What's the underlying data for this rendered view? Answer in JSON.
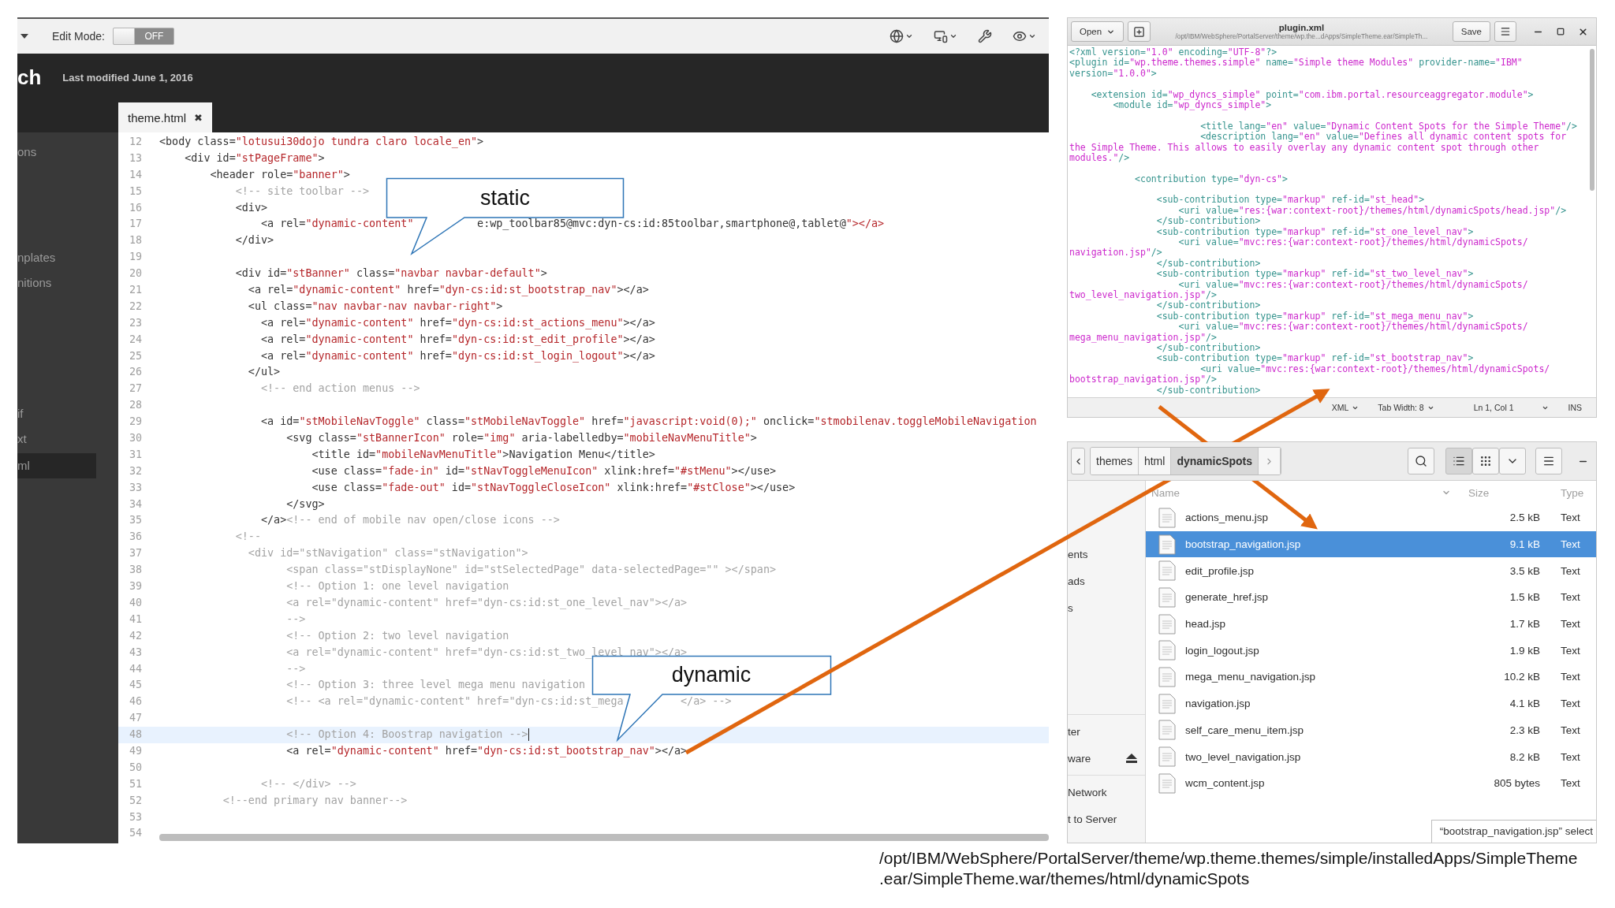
{
  "portal_toolbar": {
    "edit_mode_label": "Edit Mode:",
    "edit_mode_toggle": {
      "label": "OFF",
      "on": false
    }
  },
  "portal_header": {
    "title_fragment": "ch",
    "last_modified": "Last modified June 1, 2016"
  },
  "editor_tab": {
    "label": "theme.html",
    "close": "✖"
  },
  "sidebar_items": [
    {
      "label": "ons",
      "selected": false
    },
    {
      "label": "nplates",
      "selected": false
    },
    {
      "label": "nitions",
      "selected": false
    },
    {
      "label": "if",
      "selected": false
    },
    {
      "label": "xt",
      "selected": false
    },
    {
      "label": "ml",
      "selected": true
    }
  ],
  "code_lines": [
    {
      "number": "12",
      "text": "<body class=\"lotusui30dojo tundra claro locale_en\">",
      "current": false
    },
    {
      "number": "13",
      "text": "    <div id=\"stPageFrame\">",
      "current": false
    },
    {
      "number": "14",
      "text": "        <header role=\"banner\">",
      "current": false
    },
    {
      "number": "15",
      "text": "            <!-- site toolbar -->",
      "current": false
    },
    {
      "number": "16",
      "text": "            <div>",
      "current": false
    },
    {
      "number": "17",
      "segments": [
        "                <a rel=\"dynamic-content\" ",
        "e:wp_toolbar85@mvc:dyn-cs:id:85toolbar,smartphone@,tablet@\"></a>"
      ],
      "current": false
    },
    {
      "number": "18",
      "text": "            </div>",
      "current": false
    },
    {
      "number": "19",
      "current": false
    },
    {
      "number": "20",
      "text": "            <div id=\"stBanner\" class=\"navbar navbar-default\">",
      "current": false
    },
    {
      "number": "21",
      "text": "              <a rel=\"dynamic-content\" href=\"dyn-cs:id:st_bootstrap_nav\"></a>",
      "current": false
    },
    {
      "number": "22",
      "text": "              <ul class=\"nav navbar-nav navbar-right\">",
      "current": false
    },
    {
      "number": "23",
      "text": "                <a rel=\"dynamic-content\" href=\"dyn-cs:id:st_actions_menu\"></a>",
      "current": false
    },
    {
      "number": "24",
      "text": "                <a rel=\"dynamic-content\" href=\"dyn-cs:id:st_edit_profile\"></a>",
      "current": false
    },
    {
      "number": "25",
      "text": "                <a rel=\"dynamic-content\" href=\"dyn-cs:id:st_login_logout\"></a>",
      "current": false
    },
    {
      "number": "26",
      "text": "              </ul>",
      "current": false
    },
    {
      "number": "27",
      "text": "                <!-- end action menus -->",
      "current": false
    },
    {
      "number": "28",
      "current": false
    },
    {
      "number": "29",
      "text": "                <a id=\"stMobileNavToggle\" class=\"stMobileNavToggle\" href=\"javascript:void(0);\" onclick=\"stmobilenav.toggleMobileNavigation",
      "current": false
    },
    {
      "number": "30",
      "text": "                    <svg class=\"stBannerIcon\" role=\"img\" aria-labelledby=\"mobileNavMenuTitle\">",
      "current": false
    },
    {
      "number": "31",
      "text": "                        <title id=\"mobileNavMenuTitle\">Navigation Menu</title>",
      "current": false
    },
    {
      "number": "32",
      "text": "                        <use class=\"fade-in\" id=\"stNavToggleMenuIcon\" xlink:href=\"#stMenu\"></use>",
      "current": false
    },
    {
      "number": "33",
      "text": "                        <use class=\"fade-out\" id=\"stNavToggleCloseIcon\" xlink:href=\"#stClose\"></use>",
      "current": false
    },
    {
      "number": "34",
      "text": "                    </svg>",
      "current": false
    },
    {
      "number": "35",
      "text": "                </a><!-- end of mobile nav open/close icons -->",
      "current": false
    },
    {
      "number": "36",
      "text": "            <!--",
      "current": false
    },
    {
      "number": "37",
      "text": "              <div id=\"stNavigation\" class=\"stNavigation\">",
      "current": false
    },
    {
      "number": "38",
      "text": "                    <span class=\"stDisplayNone\" id=\"stSelectedPage\" data-selectedPage=\"\" ></span>",
      "current": false
    },
    {
      "number": "39",
      "text": "                    <!-- Option 1: one level navigation",
      "current": false
    },
    {
      "number": "40",
      "text": "                    <a rel=\"dynamic-content\" href=\"dyn-cs:id:st_one_level_nav\"></a>",
      "current": false
    },
    {
      "number": "41",
      "text": "                    -->",
      "current": false
    },
    {
      "number": "42",
      "text": "                    <!-- Option 2: two level navigation",
      "current": false
    },
    {
      "number": "43",
      "text": "                    <a rel=\"dynamic-content\" href=\"dyn-cs:id:st_two_level_nav\"></a>",
      "current": false
    },
    {
      "number": "44",
      "text": "                    -->",
      "current": false
    },
    {
      "number": "45",
      "text": "                    <!-- Option 3: three level mega menu navigation",
      "current": false
    },
    {
      "number": "46",
      "segments": [
        "                    <!-- <a rel=\"dynamic-content\" href=\"dyn-cs:id:st_mega",
        "</a> -->"
      ],
      "current": false
    },
    {
      "number": "47",
      "current": false
    },
    {
      "number": "48",
      "text": "                    <!-- Option 4: Boostrap navigation -->",
      "current": true
    },
    {
      "number": "49",
      "text": "                    <a rel=\"dynamic-content\" href=\"dyn-cs:id:st_bootstrap_nav\"></a>",
      "current": false
    },
    {
      "number": "50",
      "current": false
    },
    {
      "number": "51",
      "text": "                <!-- </div> -->",
      "current": false
    },
    {
      "number": "52",
      "text": "          <!--end primary nav banner-->",
      "current": false
    },
    {
      "number": "53",
      "current": false
    },
    {
      "number": "54",
      "current": false
    }
  ],
  "callouts": [
    {
      "text": "static"
    },
    {
      "text": "dynamic"
    }
  ],
  "text_editor": {
    "open_button": "Open",
    "title": "plugin.xml",
    "subtitle": "/opt/IBM/WebSphere/PortalServer/theme/wp.the...dApps/SimpleTheme.ear/SimpleTh...",
    "save_button": "Save",
    "blocks": [
      [
        {
          "text": "<?xml version=\"1.0\" encoding=\"UTF-8\"?>"
        },
        {
          "text": "<plugin id=\"wp.theme.themes.simple\" name=\"Simple theme Modules\" provider-name=\"IBM\""
        },
        {
          "text": "version=\"1.0.0\">"
        }
      ],
      [
        {
          "text": "    <extension id=\"wp_dyncs_simple\" point=\"com.ibm.portal.resourceaggregator.module\">"
        },
        {
          "text": "        <module id=\"wp_dyncs_simple\">"
        }
      ],
      [
        {
          "text": "                        <title lang=\"en\" value=\"Dynamic Content Spots for the Simple Theme\"/>"
        },
        {
          "text": "                        <description lang=\"en\" value=\"Defines all dynamic content spots for"
        },
        {
          "text": "the Simple Theme. This allows to easily overlay any dynamic content spot through other"
        },
        {
          "text": "modules.\"/>"
        }
      ],
      [
        {
          "text": "            <contribution type=\"dyn-cs\">"
        }
      ],
      [
        {
          "text": "                <sub-contribution type=\"markup\" ref-id=\"st_head\">"
        },
        {
          "text": "                    <uri value=\"res:{war:context-root}/themes/html/dynamicSpots/head.jsp\"/>"
        },
        {
          "text": "                </sub-contribution>"
        },
        {
          "text": "                <sub-contribution type=\"markup\" ref-id=\"st_one_level_nav\">"
        },
        {
          "text": "                    <uri value=\"mvc:res:{war:context-root}/themes/html/dynamicSpots/"
        },
        {
          "text": "navigation.jsp\"/>"
        },
        {
          "text": "                </sub-contribution>"
        },
        {
          "text": "                <sub-contribution type=\"markup\" ref-id=\"st_two_level_nav\">"
        },
        {
          "text": "                    <uri value=\"mvc:res:{war:context-root}/themes/html/dynamicSpots/"
        },
        {
          "text": "two_level_navigation.jsp\"/>"
        },
        {
          "text": "                </sub-contribution>"
        },
        {
          "text": "                <sub-contribution type=\"markup\" ref-id=\"st_mega_menu_nav\">"
        },
        {
          "text": "                    <uri value=\"mvc:res:{war:context-root}/themes/html/dynamicSpots/"
        },
        {
          "text": "mega_menu_navigation.jsp\"/>"
        },
        {
          "text": "                </sub-contribution>"
        },
        {
          "text": "                <sub-contribution type=\"markup\" ref-id=\"st_bootstrap_nav\">"
        },
        {
          "text": "                        <uri value=\"mvc:res:{war:context-root}/themes/html/dynamicSpots/"
        },
        {
          "text": "bootstrap_navigation.jsp\"/>"
        },
        {
          "text": "                </sub-contribution>"
        }
      ]
    ],
    "status": {
      "language": "XML",
      "tab_width": "Tab Width: 8",
      "position": "Ln 1, Col 1",
      "mode": "INS"
    }
  },
  "file_manager": {
    "breadcrumbs": [
      {
        "label": "themes",
        "selected": false
      },
      {
        "label": "html",
        "selected": false
      },
      {
        "label": "dynamicSpots",
        "selected": true
      }
    ],
    "sidebar_sections": [
      [
        {
          "label": "ents",
          "ejectable": false
        },
        {
          "label": "ads",
          "ejectable": false
        },
        {
          "label": "s",
          "ejectable": false
        }
      ],
      [
        {
          "label": "ter",
          "ejectable": false
        },
        {
          "label": "ware",
          "ejectable": true
        }
      ],
      [
        {
          "label": "Network",
          "ejectable": false
        },
        {
          "label": "t to Server",
          "ejectable": false
        }
      ]
    ],
    "columns": [
      "Name",
      "Size",
      "Type"
    ],
    "rows": [
      {
        "name": "actions_menu.jsp",
        "size": "2.5 kB",
        "type": "Text",
        "selected": false
      },
      {
        "name": "bootstrap_navigation.jsp",
        "size": "9.1 kB",
        "type": "Text",
        "selected": true
      },
      {
        "name": "edit_profile.jsp",
        "size": "3.5 kB",
        "type": "Text",
        "selected": false
      },
      {
        "name": "generate_href.jsp",
        "size": "1.5 kB",
        "type": "Text",
        "selected": false
      },
      {
        "name": "head.jsp",
        "size": "1.7 kB",
        "type": "Text",
        "selected": false
      },
      {
        "name": "login_logout.jsp",
        "size": "1.9 kB",
        "type": "Text",
        "selected": false
      },
      {
        "name": "mega_menu_navigation.jsp",
        "size": "10.2 kB",
        "type": "Text",
        "selected": false
      },
      {
        "name": "navigation.jsp",
        "size": "4.1 kB",
        "type": "Text",
        "selected": false
      },
      {
        "name": "self_care_menu_item.jsp",
        "size": "2.3 kB",
        "type": "Text",
        "selected": false
      },
      {
        "name": "two_level_navigation.jsp",
        "size": "8.2 kB",
        "type": "Text",
        "selected": false
      },
      {
        "name": "wcm_content.jsp",
        "size": "805 bytes",
        "type": "Text",
        "selected": false
      }
    ],
    "status": "“bootstrap_navigation.jsp” select"
  },
  "caption_lines": [
    "/opt/IBM/WebSphere/PortalServer/theme/wp.theme.themes/simple/installedApps/SimpleTheme",
    ".ear/SimpleTheme.war/themes/html/dynamicSpots"
  ]
}
